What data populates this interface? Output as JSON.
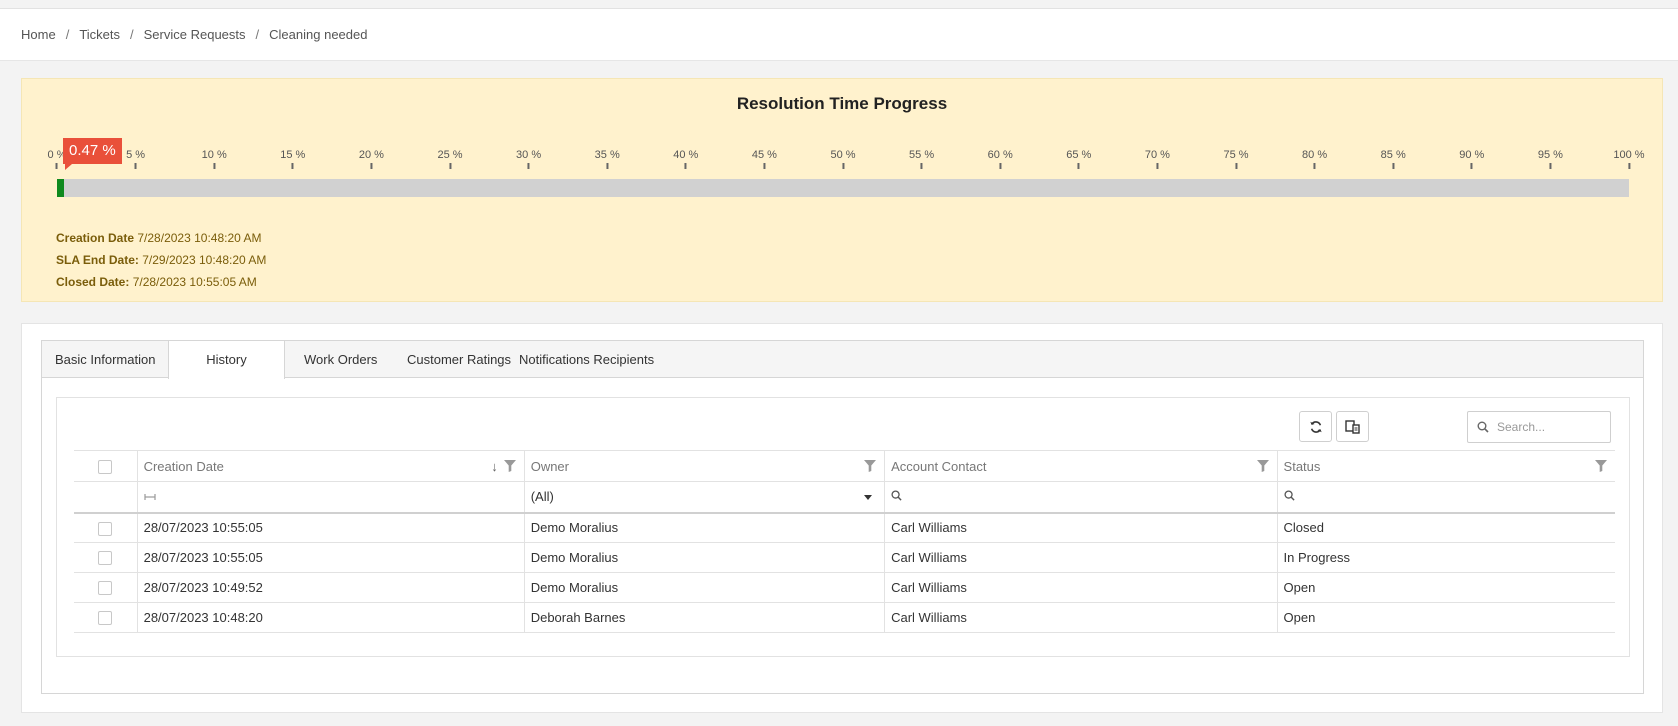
{
  "breadcrumb": [
    "Home",
    "Tickets",
    "Service Requests",
    "Cleaning needed"
  ],
  "sla": {
    "title": "Resolution Time Progress",
    "progress_percent": 0.47,
    "badge_text": "0.47 %",
    "ticks": [
      "0 %",
      "5 %",
      "10 %",
      "15 %",
      "20 %",
      "25 %",
      "30 %",
      "35 %",
      "40 %",
      "45 %",
      "50 %",
      "55 %",
      "60 %",
      "65 %",
      "70 %",
      "75 %",
      "80 %",
      "85 %",
      "90 %",
      "95 %",
      "100 %"
    ],
    "creation_label": "Creation Date",
    "creation_value": "7/28/2023 10:48:20 AM",
    "sla_end_label": "SLA End Date:",
    "sla_end_value": "7/29/2023 10:48:20 AM",
    "closed_label": "Closed Date:",
    "closed_value": "7/28/2023 10:55:05 AM",
    "colors": {
      "panel": "#fff2cd",
      "fill": "#0f8a1e",
      "badge": "#e9503a"
    }
  },
  "tabs": [
    "Basic Information",
    "History",
    "Work Orders",
    "Customer Ratings",
    "Notifications Recipients"
  ],
  "active_tab": "History",
  "grid": {
    "search_placeholder": "Search...",
    "columns": [
      "Creation Date",
      "Owner",
      "Account Contact",
      "Status"
    ],
    "owner_filter": "(All)",
    "rows": [
      {
        "date": "28/07/2023 10:55:05",
        "owner": "Demo Moralius",
        "contact": "Carl Williams",
        "status": "Closed"
      },
      {
        "date": "28/07/2023 10:55:05",
        "owner": "Demo Moralius",
        "contact": "Carl Williams",
        "status": "In Progress"
      },
      {
        "date": "28/07/2023 10:49:52",
        "owner": "Demo Moralius",
        "contact": "Carl Williams",
        "status": "Open"
      },
      {
        "date": "28/07/2023 10:48:20",
        "owner": "Deborah Barnes",
        "contact": "Carl Williams",
        "status": "Open"
      }
    ]
  }
}
